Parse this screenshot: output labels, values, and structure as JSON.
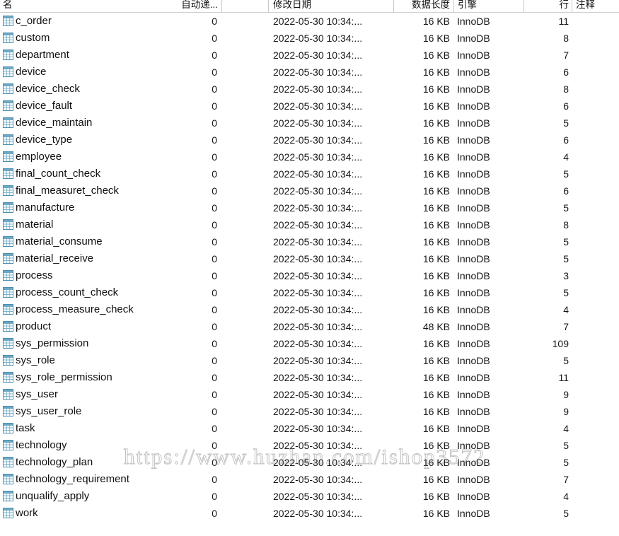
{
  "grid": {
    "columns": [
      {
        "key": "name",
        "label": "名"
      },
      {
        "key": "auto",
        "label": "自动递..."
      },
      {
        "key": "date",
        "label": "修改日期"
      },
      {
        "key": "size",
        "label": "数据长度"
      },
      {
        "key": "engine",
        "label": "引擎"
      },
      {
        "key": "rows",
        "label": "行"
      },
      {
        "key": "comment",
        "label": "注释"
      }
    ],
    "icon": "table-grid-icon",
    "accent_color": "#4a8fb0",
    "rows": [
      {
        "name": "c_order",
        "auto": "0",
        "date": "2022-05-30 10:34:...",
        "size": "16 KB",
        "engine": "InnoDB",
        "rows": "11",
        "comment": ""
      },
      {
        "name": "custom",
        "auto": "0",
        "date": "2022-05-30 10:34:...",
        "size": "16 KB",
        "engine": "InnoDB",
        "rows": "8",
        "comment": ""
      },
      {
        "name": "department",
        "auto": "0",
        "date": "2022-05-30 10:34:...",
        "size": "16 KB",
        "engine": "InnoDB",
        "rows": "7",
        "comment": ""
      },
      {
        "name": "device",
        "auto": "0",
        "date": "2022-05-30 10:34:...",
        "size": "16 KB",
        "engine": "InnoDB",
        "rows": "6",
        "comment": ""
      },
      {
        "name": "device_check",
        "auto": "0",
        "date": "2022-05-30 10:34:...",
        "size": "16 KB",
        "engine": "InnoDB",
        "rows": "8",
        "comment": ""
      },
      {
        "name": "device_fault",
        "auto": "0",
        "date": "2022-05-30 10:34:...",
        "size": "16 KB",
        "engine": "InnoDB",
        "rows": "6",
        "comment": ""
      },
      {
        "name": "device_maintain",
        "auto": "0",
        "date": "2022-05-30 10:34:...",
        "size": "16 KB",
        "engine": "InnoDB",
        "rows": "5",
        "comment": ""
      },
      {
        "name": "device_type",
        "auto": "0",
        "date": "2022-05-30 10:34:...",
        "size": "16 KB",
        "engine": "InnoDB",
        "rows": "6",
        "comment": ""
      },
      {
        "name": "employee",
        "auto": "0",
        "date": "2022-05-30 10:34:...",
        "size": "16 KB",
        "engine": "InnoDB",
        "rows": "4",
        "comment": ""
      },
      {
        "name": "final_count_check",
        "auto": "0",
        "date": "2022-05-30 10:34:...",
        "size": "16 KB",
        "engine": "InnoDB",
        "rows": "5",
        "comment": ""
      },
      {
        "name": "final_measuret_check",
        "auto": "0",
        "date": "2022-05-30 10:34:...",
        "size": "16 KB",
        "engine": "InnoDB",
        "rows": "6",
        "comment": ""
      },
      {
        "name": "manufacture",
        "auto": "0",
        "date": "2022-05-30 10:34:...",
        "size": "16 KB",
        "engine": "InnoDB",
        "rows": "5",
        "comment": ""
      },
      {
        "name": "material",
        "auto": "0",
        "date": "2022-05-30 10:34:...",
        "size": "16 KB",
        "engine": "InnoDB",
        "rows": "8",
        "comment": ""
      },
      {
        "name": "material_consume",
        "auto": "0",
        "date": "2022-05-30 10:34:...",
        "size": "16 KB",
        "engine": "InnoDB",
        "rows": "5",
        "comment": ""
      },
      {
        "name": "material_receive",
        "auto": "0",
        "date": "2022-05-30 10:34:...",
        "size": "16 KB",
        "engine": "InnoDB",
        "rows": "5",
        "comment": ""
      },
      {
        "name": "process",
        "auto": "0",
        "date": "2022-05-30 10:34:...",
        "size": "16 KB",
        "engine": "InnoDB",
        "rows": "3",
        "comment": ""
      },
      {
        "name": "process_count_check",
        "auto": "0",
        "date": "2022-05-30 10:34:...",
        "size": "16 KB",
        "engine": "InnoDB",
        "rows": "5",
        "comment": ""
      },
      {
        "name": "process_measure_check",
        "auto": "0",
        "date": "2022-05-30 10:34:...",
        "size": "16 KB",
        "engine": "InnoDB",
        "rows": "4",
        "comment": ""
      },
      {
        "name": "product",
        "auto": "0",
        "date": "2022-05-30 10:34:...",
        "size": "48 KB",
        "engine": "InnoDB",
        "rows": "7",
        "comment": ""
      },
      {
        "name": "sys_permission",
        "auto": "0",
        "date": "2022-05-30 10:34:...",
        "size": "16 KB",
        "engine": "InnoDB",
        "rows": "109",
        "comment": ""
      },
      {
        "name": "sys_role",
        "auto": "0",
        "date": "2022-05-30 10:34:...",
        "size": "16 KB",
        "engine": "InnoDB",
        "rows": "5",
        "comment": ""
      },
      {
        "name": "sys_role_permission",
        "auto": "0",
        "date": "2022-05-30 10:34:...",
        "size": "16 KB",
        "engine": "InnoDB",
        "rows": "11",
        "comment": ""
      },
      {
        "name": "sys_user",
        "auto": "0",
        "date": "2022-05-30 10:34:...",
        "size": "16 KB",
        "engine": "InnoDB",
        "rows": "9",
        "comment": ""
      },
      {
        "name": "sys_user_role",
        "auto": "0",
        "date": "2022-05-30 10:34:...",
        "size": "16 KB",
        "engine": "InnoDB",
        "rows": "9",
        "comment": ""
      },
      {
        "name": "task",
        "auto": "0",
        "date": "2022-05-30 10:34:...",
        "size": "16 KB",
        "engine": "InnoDB",
        "rows": "4",
        "comment": ""
      },
      {
        "name": "technology",
        "auto": "0",
        "date": "2022-05-30 10:34:...",
        "size": "16 KB",
        "engine": "InnoDB",
        "rows": "5",
        "comment": ""
      },
      {
        "name": "technology_plan",
        "auto": "0",
        "date": "2022-05-30 10:34:...",
        "size": "16 KB",
        "engine": "InnoDB",
        "rows": "5",
        "comment": ""
      },
      {
        "name": "technology_requirement",
        "auto": "0",
        "date": "2022-05-30 10:34:...",
        "size": "16 KB",
        "engine": "InnoDB",
        "rows": "7",
        "comment": ""
      },
      {
        "name": "unqualify_apply",
        "auto": "0",
        "date": "2022-05-30 10:34:...",
        "size": "16 KB",
        "engine": "InnoDB",
        "rows": "4",
        "comment": ""
      },
      {
        "name": "work",
        "auto": "0",
        "date": "2022-05-30 10:34:...",
        "size": "16 KB",
        "engine": "InnoDB",
        "rows": "5",
        "comment": ""
      }
    ]
  },
  "watermark": {
    "text": "https://www.huzhan.com/ishop3572"
  }
}
